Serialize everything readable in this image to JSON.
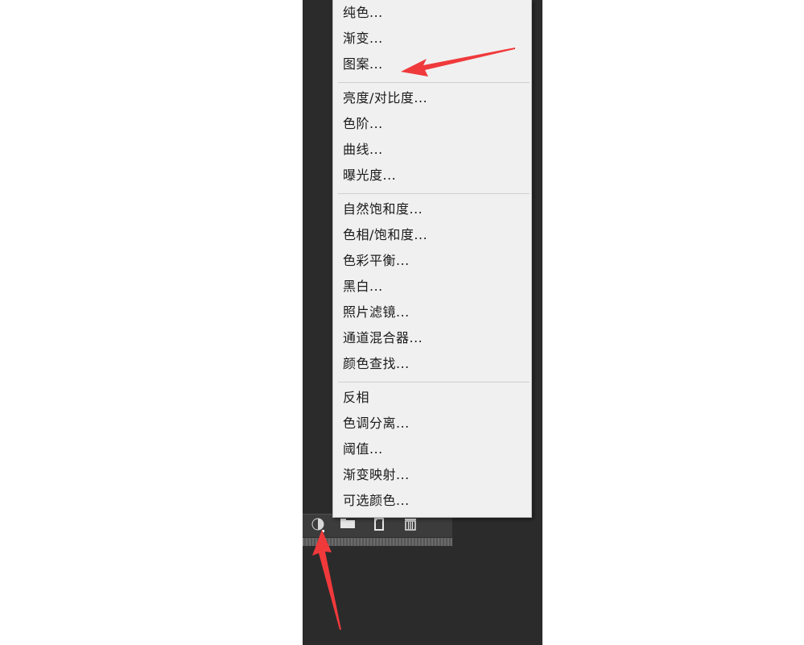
{
  "menu": {
    "groups": [
      [
        "纯色...",
        "渐变...",
        "图案..."
      ],
      [
        "亮度/对比度...",
        "色阶...",
        "曲线...",
        "曝光度..."
      ],
      [
        "自然饱和度...",
        "色相/饱和度...",
        "色彩平衡...",
        "黑白...",
        "照片滤镜...",
        "通道混合器...",
        "颜色查找..."
      ],
      [
        "反相",
        "色调分离...",
        "阈值...",
        "渐变映射...",
        "可选颜色..."
      ]
    ]
  },
  "toolbar": {
    "icons": [
      "adjustment-layer-icon",
      "folder-icon",
      "new-layer-icon",
      "trash-icon"
    ]
  },
  "annotations": {
    "arrow_color": "#f0393b",
    "pointed_item": "图案..."
  },
  "colors": {
    "panel_bg": "#2b2b2b",
    "menu_bg": "#f0f0f0"
  }
}
